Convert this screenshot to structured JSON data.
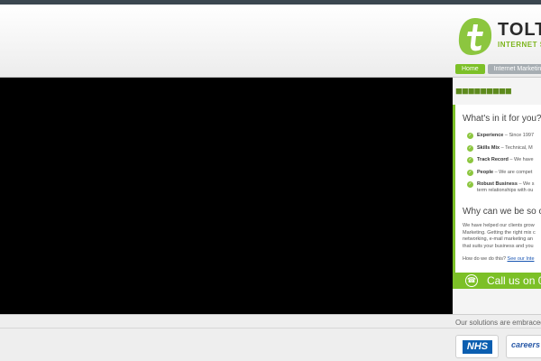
{
  "logo": {
    "name": "TOLT",
    "tagline": "INTERNET SO"
  },
  "nav": {
    "items": [
      {
        "label": "Home"
      },
      {
        "label": "Internet Marketing"
      }
    ]
  },
  "panel": {
    "title": "What's in it for you?",
    "benefits": [
      {
        "label": "Experience",
        "text": "– Since 1997"
      },
      {
        "label": "Skills Mix",
        "text": "– Technical, M"
      },
      {
        "label": "Track Record",
        "text": "– We have"
      },
      {
        "label": "People",
        "text": "– We are compet"
      },
      {
        "label": "Robust Business",
        "text": "– We s",
        "cont": "term relationships with ou"
      }
    ],
    "why_title": "Why can we be so c",
    "paragraph": [
      "We have helped our clients grow",
      "Marketing. Getting the right mix c",
      "networking, e-mail marketing an",
      "that suits your business and you"
    ],
    "how_text": "How do we do this?",
    "how_link": "See our Inte"
  },
  "call": {
    "text": "Call us on 0"
  },
  "footer": {
    "text": "Our solutions are embraced",
    "badges": [
      {
        "label": "NHS"
      },
      {
        "label": "careers"
      }
    ]
  },
  "colors": {
    "accent_green": "#7cc027",
    "top_bar": "#3b4750",
    "link_blue": "#1a56b3"
  }
}
